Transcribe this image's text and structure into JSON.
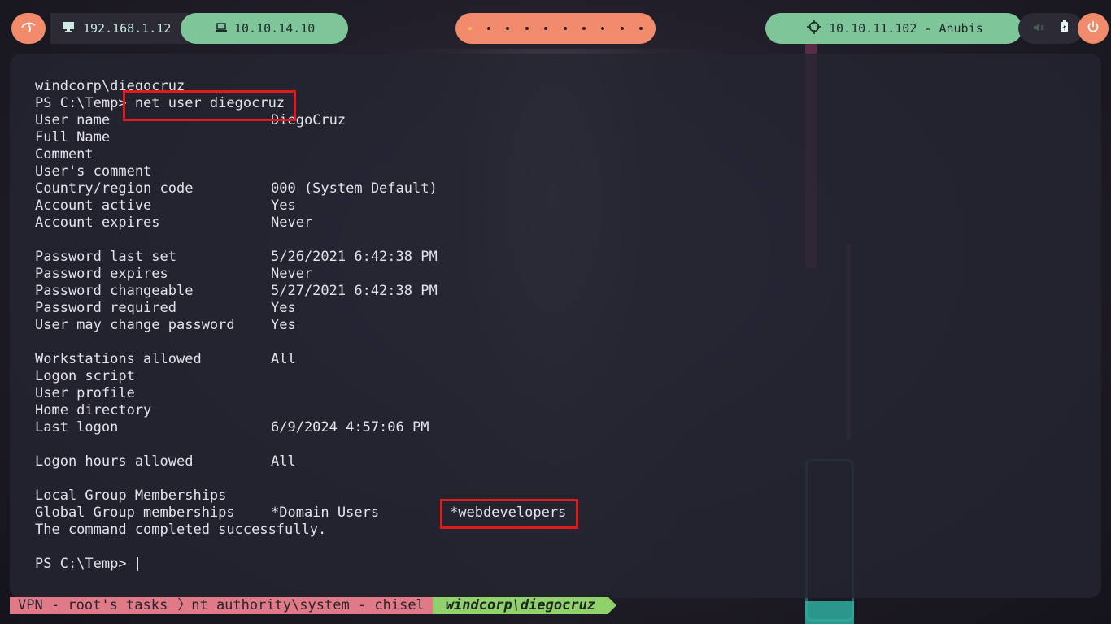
{
  "topbar": {
    "kali_icon": "kali-dragon-icon",
    "local_ip": "192.168.1.12",
    "vpn_ip": "10.10.14.10",
    "workspaces_count": 10,
    "active_workspace": 1,
    "target": "10.10.11.102 - Anubis",
    "icons": [
      "monitor-icon",
      "laptop-icon",
      "crosshair-icon",
      "volume-icon",
      "battery-icon",
      "power-icon"
    ]
  },
  "terminal": {
    "lines": [
      {
        "label": "windcorp\\diegocruz"
      },
      {
        "label": "PS C:\\Temp> net user diegocruz"
      },
      {
        "label": "User name",
        "value": "DiegoCruz"
      },
      {
        "label": "Full Name",
        "value": ""
      },
      {
        "label": "Comment",
        "value": ""
      },
      {
        "label": "User's comment",
        "value": ""
      },
      {
        "label": "Country/region code",
        "value": "000 (System Default)"
      },
      {
        "label": "Account active",
        "value": "Yes"
      },
      {
        "label": "Account expires",
        "value": "Never"
      },
      {
        "label": ""
      },
      {
        "label": "Password last set",
        "value": "5/26/2021 6:42:38 PM"
      },
      {
        "label": "Password expires",
        "value": "Never"
      },
      {
        "label": "Password changeable",
        "value": "5/27/2021 6:42:38 PM"
      },
      {
        "label": "Password required",
        "value": "Yes"
      },
      {
        "label": "User may change password",
        "value": "Yes"
      },
      {
        "label": ""
      },
      {
        "label": "Workstations allowed",
        "value": "All"
      },
      {
        "label": "Logon script",
        "value": ""
      },
      {
        "label": "User profile",
        "value": ""
      },
      {
        "label": "Home directory",
        "value": ""
      },
      {
        "label": "Last logon",
        "value": "6/9/2024 4:57:06 PM"
      },
      {
        "label": ""
      },
      {
        "label": "Logon hours allowed",
        "value": "All"
      },
      {
        "label": ""
      },
      {
        "label": "Local Group Memberships",
        "value": ""
      },
      {
        "label": "Global Group memberships",
        "value": "*Domain Users",
        "value2": "*webdevelopers"
      },
      {
        "label": "The command completed successfully."
      },
      {
        "label": ""
      },
      {
        "label": "PS C:\\Temp> "
      }
    ]
  },
  "statusbar": {
    "seg1": "VPN - root's tasks",
    "seg2": "nt authority\\system - chisel",
    "seg3": "windcorp\\diegocruz"
  },
  "colors": {
    "highlight": "#e01b1b",
    "accent_orange": "#f28b6c",
    "accent_green": "#7fc59a",
    "status_pink": "#e07a86",
    "status_green": "#8fd16b"
  }
}
